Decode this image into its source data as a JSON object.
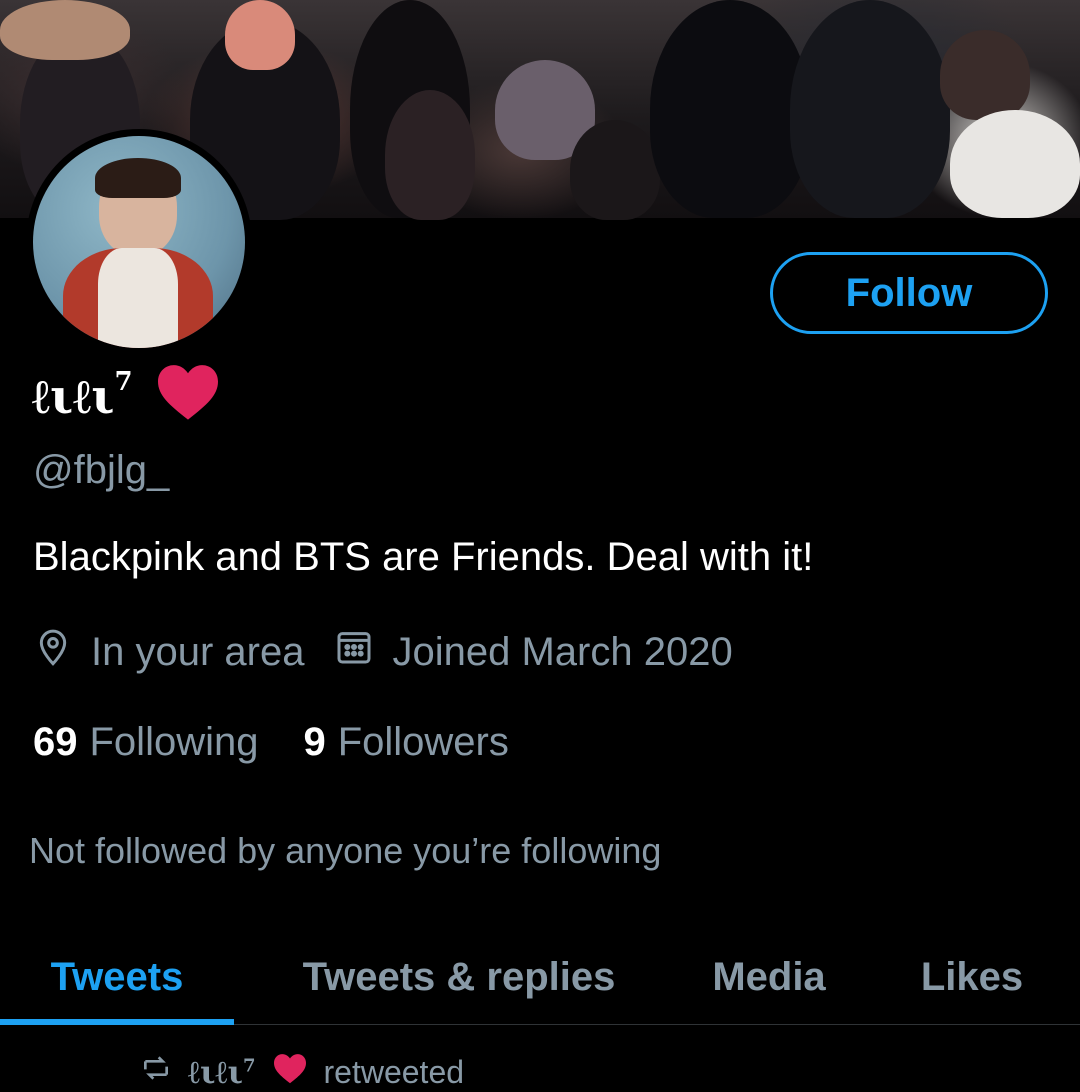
{
  "profile": {
    "display_name": "ℓιℓι",
    "display_name_sup": "7",
    "heart_icon": "heart-icon",
    "handle": "@fbjlg_",
    "bio": "Blackpink and BTS are Friends. Deal with it!",
    "location": "In your area",
    "joined": "Joined March 2020",
    "following_count": "69",
    "following_label": "Following",
    "followers_count": "9",
    "followers_label": "Followers",
    "not_followed_text": "Not followed by anyone you’re following"
  },
  "actions": {
    "follow_label": "Follow"
  },
  "tabs": [
    {
      "label": "Tweets",
      "active": true
    },
    {
      "label": "Tweets & replies",
      "active": false
    },
    {
      "label": "Media",
      "active": false
    },
    {
      "label": "Likes",
      "active": false
    }
  ],
  "timeline": {
    "retweet_name": "ℓιℓι",
    "retweet_sup": "7",
    "retweet_text": "retweeted"
  },
  "colors": {
    "accent": "#1da1f2",
    "background": "#000000",
    "secondary_text": "#8899a6",
    "heart": "#e0245e"
  },
  "icons": [
    "location-pin-icon",
    "calendar-icon",
    "retweet-icon",
    "heart-icon"
  ]
}
